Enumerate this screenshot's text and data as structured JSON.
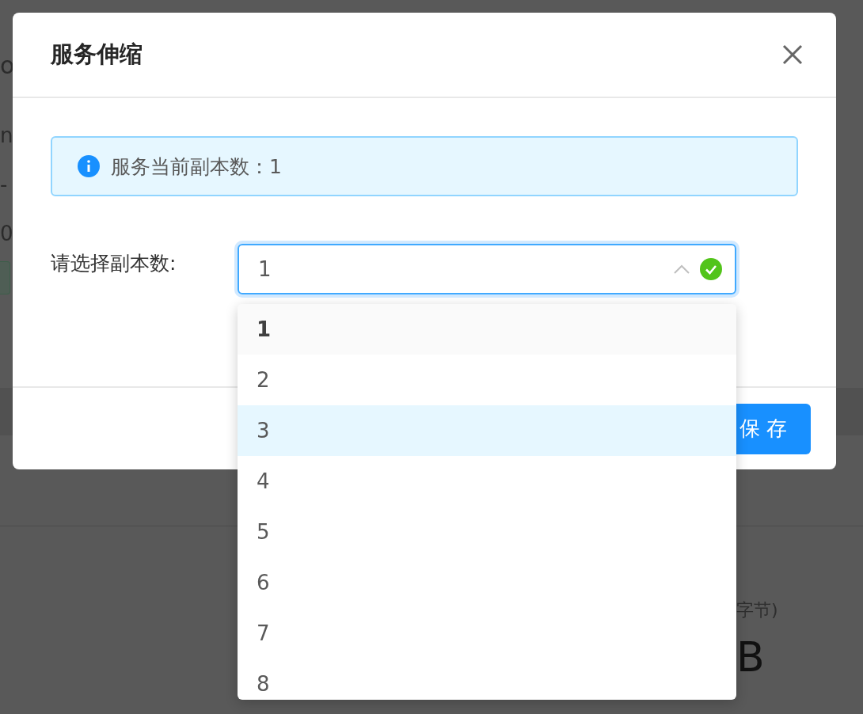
{
  "background": {
    "left_fragments": [
      "o",
      "n",
      "-",
      "0"
    ],
    "right_fragments": [
      "字节)",
      "B"
    ]
  },
  "modal": {
    "title": "服务伸缩",
    "alert": "服务当前副本数：1",
    "form": {
      "label": "请选择副本数:",
      "value": "1",
      "valid": true,
      "expanded": true
    },
    "options": [
      {
        "label": "1",
        "selected": true,
        "hovered": false
      },
      {
        "label": "2",
        "selected": false,
        "hovered": false
      },
      {
        "label": "3",
        "selected": false,
        "hovered": true
      },
      {
        "label": "4",
        "selected": false,
        "hovered": false
      },
      {
        "label": "5",
        "selected": false,
        "hovered": false
      },
      {
        "label": "6",
        "selected": false,
        "hovered": false
      },
      {
        "label": "7",
        "selected": false,
        "hovered": false
      },
      {
        "label": "8",
        "selected": false,
        "hovered": false
      }
    ],
    "save_button": "保 存"
  }
}
